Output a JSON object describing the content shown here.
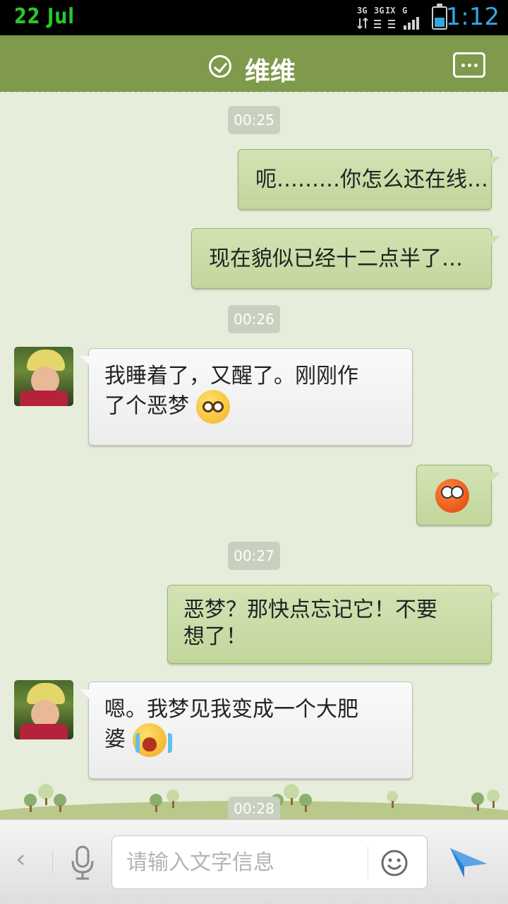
{
  "status_bar": {
    "date": "22  Jul",
    "network_labels": [
      "3G",
      "3G",
      "IX",
      "G"
    ],
    "time": "1:12",
    "battery_level_fraction": 0.45
  },
  "header": {
    "contact_name": "维维"
  },
  "messages": [
    {
      "kind": "time",
      "text": "00:25"
    },
    {
      "kind": "out",
      "text": "呃………你怎么还在线…"
    },
    {
      "kind": "out",
      "text": "现在貌似已经十二点半了…"
    },
    {
      "kind": "time",
      "text": "00:26"
    },
    {
      "kind": "in",
      "line1": "我睡着了，又醒了。刚刚作",
      "line2": "了个恶梦",
      "emoji": "pleading-face-icon"
    },
    {
      "kind": "out",
      "emoji": "angry-face-icon"
    },
    {
      "kind": "time",
      "text": "00:27"
    },
    {
      "kind": "out",
      "line1": "恶梦？那快点忘记它！不要",
      "line2": "想了！"
    },
    {
      "kind": "in",
      "line1": "嗯。我梦见我变成一个大肥",
      "line2": "婆",
      "emoji": "crying-face-icon"
    },
    {
      "kind": "time",
      "text": "00:28"
    }
  ],
  "input_bar": {
    "back_label": "‹",
    "placeholder": "请输入文字信息"
  },
  "colors": {
    "header_green": "#7f9a4c",
    "outgoing_bubble": "#c8dba6",
    "incoming_bubble": "#f4f4f4",
    "status_time": "#33a8e0",
    "status_date": "#2cc42c",
    "send_arrow": "#2f7fd0"
  }
}
